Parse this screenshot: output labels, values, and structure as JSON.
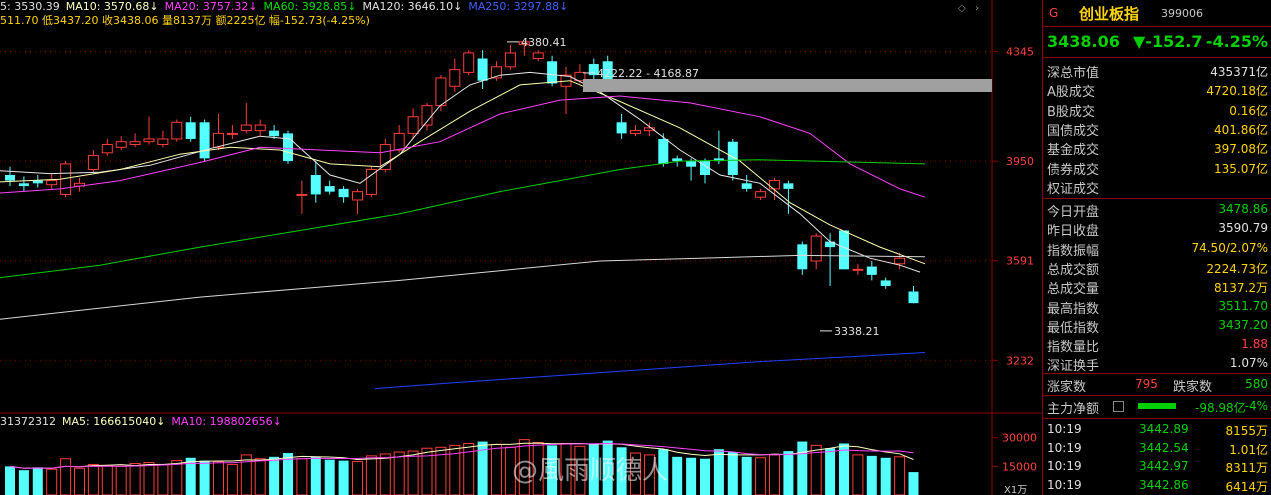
{
  "top_info": [
    {
      "text": "5: 3530.39",
      "color": "#e0e0e0"
    },
    {
      "text": "MA10: 3570.68",
      "color": "#ffffc0"
    },
    {
      "text": "MA20: 3757.32",
      "color": "#ff40ff"
    },
    {
      "text": "MA60: 3928.85",
      "color": "#00e000"
    },
    {
      "text": "MA120: 3646.10",
      "color": "#e0e0e0"
    },
    {
      "text": "MA250: 3297.88",
      "color": "#4060ff"
    }
  ],
  "second_info": "511.70 低3437.20 收3438.06 量8137万 额2225亿 幅-152.73(-4.25%)",
  "vol_info": [
    {
      "text": "31372312",
      "color": "#e0e0e0"
    },
    {
      "text": "MA5: 166615040",
      "color": "#ffffc0"
    },
    {
      "text": "MA10: 198802656",
      "color": "#ff40ff"
    }
  ],
  "chart_data": {
    "type": "candlestick",
    "yticks": [
      4345,
      3950,
      3591,
      3232
    ],
    "ylim": [
      3060,
      4430
    ],
    "vticks": [
      "30000",
      "15000"
    ],
    "vol_unit": "X1万",
    "candles": [
      [
        3900,
        3880,
        3930,
        3860
      ],
      [
        3870,
        3860,
        3895,
        3840
      ],
      [
        3880,
        3870,
        3900,
        3855
      ],
      [
        3865,
        3880,
        3905,
        3850
      ],
      [
        3830,
        3940,
        3950,
        3820
      ],
      [
        3860,
        3870,
        3890,
        3840
      ],
      [
        3920,
        3970,
        3990,
        3910
      ],
      [
        3980,
        4010,
        4030,
        3970
      ],
      [
        4000,
        4020,
        4040,
        3990
      ],
      [
        4010,
        4020,
        4050,
        4000
      ],
      [
        4020,
        4030,
        4110,
        4010
      ],
      [
        4010,
        4030,
        4060,
        4000
      ],
      [
        4030,
        4090,
        4100,
        4020
      ],
      [
        4090,
        4030,
        4110,
        4020
      ],
      [
        4090,
        3960,
        4100,
        3950
      ],
      [
        4000,
        4050,
        4120,
        3990
      ],
      [
        4050,
        4050,
        4080,
        4030
      ],
      [
        4060,
        4080,
        4160,
        4050
      ],
      [
        4060,
        4080,
        4100,
        4040
      ],
      [
        4060,
        4040,
        4080,
        4030
      ],
      [
        4050,
        3950,
        4060,
        3940
      ],
      [
        3830,
        3830,
        3880,
        3760
      ],
      [
        3900,
        3830,
        3950,
        3800
      ],
      [
        3860,
        3840,
        3880,
        3830
      ],
      [
        3850,
        3820,
        3860,
        3800
      ],
      [
        3810,
        3840,
        3850,
        3760
      ],
      [
        3830,
        3920,
        3930,
        3820
      ],
      [
        3920,
        4010,
        4030,
        3910
      ],
      [
        3990,
        4050,
        4080,
        3980
      ],
      [
        4050,
        4110,
        4140,
        4030
      ],
      [
        4080,
        4150,
        4160,
        4060
      ],
      [
        4150,
        4250,
        4260,
        4130
      ],
      [
        4220,
        4280,
        4320,
        4200
      ],
      [
        4270,
        4340,
        4350,
        4260
      ],
      [
        4320,
        4240,
        4350,
        4210
      ],
      [
        4250,
        4290,
        4310,
        4240
      ],
      [
        4290,
        4340,
        4370,
        4280
      ],
      [
        4370,
        4380,
        4381,
        4330
      ],
      [
        4320,
        4340,
        4350,
        4310
      ],
      [
        4310,
        4230,
        4330,
        4220
      ],
      [
        4220,
        4260,
        4290,
        4120
      ],
      [
        4240,
        4270,
        4300,
        4230
      ],
      [
        4300,
        4260,
        4320,
        4230
      ],
      [
        4310,
        4220,
        4330,
        4210
      ],
      [
        4090,
        4050,
        4120,
        4030
      ],
      [
        4050,
        4060,
        4080,
        4040
      ],
      [
        4060,
        4070,
        4090,
        4040
      ],
      [
        4030,
        3940,
        4050,
        3930
      ],
      [
        3960,
        3950,
        3970,
        3930
      ],
      [
        3950,
        3930,
        3960,
        3880
      ],
      [
        3950,
        3900,
        3960,
        3870
      ],
      [
        3960,
        3950,
        4060,
        3940
      ],
      [
        4020,
        3900,
        4030,
        3880
      ],
      [
        3870,
        3850,
        3900,
        3840
      ],
      [
        3820,
        3840,
        3850,
        3810
      ],
      [
        3850,
        3880,
        3890,
        3810
      ],
      [
        3870,
        3850,
        3880,
        3760
      ],
      [
        3650,
        3560,
        3660,
        3540
      ],
      [
        3590,
        3680,
        3690,
        3560
      ],
      [
        3660,
        3640,
        3690,
        3500
      ],
      [
        3700,
        3560,
        3700,
        3560
      ],
      [
        3560,
        3560,
        3580,
        3540
      ],
      [
        3570,
        3540,
        3590,
        3520
      ],
      [
        3520,
        3500,
        3530,
        3490
      ],
      [
        3580,
        3600,
        3620,
        3560
      ],
      [
        3480,
        3438,
        3500,
        3437
      ]
    ],
    "ma": [
      {
        "name": "MA5",
        "color": "#e8e8e8",
        "points": [
          [
            0,
            3915
          ],
          [
            50,
            3905
          ],
          [
            100,
            3910
          ],
          [
            150,
            3935
          ],
          [
            210,
            3995
          ],
          [
            260,
            4040
          ],
          [
            290,
            4030
          ],
          [
            330,
            3900
          ],
          [
            360,
            3870
          ],
          [
            400,
            3975
          ],
          [
            440,
            4150
          ],
          [
            470,
            4225
          ],
          [
            500,
            4260
          ],
          [
            530,
            4270
          ],
          [
            570,
            4255
          ],
          [
            600,
            4200
          ],
          [
            640,
            4100
          ],
          [
            680,
            3990
          ],
          [
            720,
            3900
          ],
          [
            760,
            3870
          ],
          [
            800,
            3760
          ],
          [
            830,
            3660
          ],
          [
            870,
            3600
          ],
          [
            900,
            3575
          ],
          [
            920,
            3550
          ]
        ]
      },
      {
        "name": "MA10",
        "color": "#ffffb0",
        "points": [
          [
            0,
            3875
          ],
          [
            60,
            3885
          ],
          [
            120,
            3920
          ],
          [
            180,
            3975
          ],
          [
            230,
            4000
          ],
          [
            280,
            3990
          ],
          [
            330,
            3940
          ],
          [
            380,
            3930
          ],
          [
            420,
            4020
          ],
          [
            470,
            4130
          ],
          [
            520,
            4225
          ],
          [
            570,
            4240
          ],
          [
            620,
            4165
          ],
          [
            680,
            4070
          ],
          [
            740,
            3950
          ],
          [
            790,
            3800
          ],
          [
            830,
            3720
          ],
          [
            880,
            3640
          ],
          [
            925,
            3580
          ]
        ]
      },
      {
        "name": "MA20",
        "color": "#ff40ff",
        "points": [
          [
            0,
            3835
          ],
          [
            60,
            3850
          ],
          [
            120,
            3880
          ],
          [
            200,
            3945
          ],
          [
            260,
            4000
          ],
          [
            320,
            3990
          ],
          [
            380,
            3980
          ],
          [
            440,
            4020
          ],
          [
            500,
            4120
          ],
          [
            560,
            4170
          ],
          [
            620,
            4185
          ],
          [
            690,
            4160
          ],
          [
            760,
            4110
          ],
          [
            810,
            4050
          ],
          [
            850,
            3940
          ],
          [
            900,
            3850
          ],
          [
            925,
            3820
          ]
        ]
      },
      {
        "name": "MA60",
        "color": "#00d000",
        "points": [
          [
            0,
            3530
          ],
          [
            100,
            3575
          ],
          [
            200,
            3640
          ],
          [
            300,
            3700
          ],
          [
            400,
            3760
          ],
          [
            500,
            3840
          ],
          [
            560,
            3880
          ],
          [
            620,
            3920
          ],
          [
            680,
            3950
          ],
          [
            760,
            3955
          ],
          [
            840,
            3948
          ],
          [
            925,
            3940
          ]
        ]
      },
      {
        "name": "MA120",
        "color": "#d8d8d8",
        "points": [
          [
            0,
            3380
          ],
          [
            100,
            3420
          ],
          [
            200,
            3460
          ],
          [
            300,
            3490
          ],
          [
            400,
            3520
          ],
          [
            500,
            3555
          ],
          [
            600,
            3590
          ],
          [
            700,
            3600
          ],
          [
            800,
            3610
          ],
          [
            925,
            3605
          ]
        ]
      },
      {
        "name": "MA250",
        "color": "#2040ff",
        "points": [
          [
            375,
            3130
          ],
          [
            450,
            3150
          ],
          [
            550,
            3175
          ],
          [
            650,
            3200
          ],
          [
            750,
            3225
          ],
          [
            850,
            3245
          ],
          [
            925,
            3260
          ]
        ]
      }
    ],
    "annotations": [
      {
        "text": "4380.41",
        "x": 507,
        "price": 4380
      },
      {
        "text": "4222.22 - 4168.87",
        "x": 583,
        "price": 4268
      },
      {
        "text": "3338.21",
        "x": 820,
        "price": 3338
      }
    ],
    "volumes": [
      15000,
      13000,
      14500,
      13500,
      19000,
      14000,
      16000,
      15500,
      15000,
      16500,
      17000,
      16000,
      18000,
      19500,
      18000,
      17500,
      16000,
      21000,
      19000,
      20000,
      22000,
      19000,
      20000,
      18500,
      18000,
      17500,
      20500,
      21500,
      22500,
      23000,
      24500,
      25000,
      26000,
      27000,
      28000,
      26500,
      25000,
      29000,
      27500,
      26000,
      27000,
      25500,
      27000,
      28500,
      25000,
      22000,
      21000,
      24000,
      20000,
      19500,
      19000,
      24000,
      22500,
      20000,
      19500,
      21000,
      23000,
      28000,
      26000,
      24500,
      27000,
      21000,
      20500,
      19500,
      20000,
      12000
    ]
  },
  "side": {
    "g_label": "G",
    "name": "创业板指",
    "code": "399006",
    "price": "3438.06",
    "change": "▼-152.7",
    "pct": "-4.25%",
    "market_rows": [
      {
        "k": "深总市值",
        "v": "435371亿",
        "c": "#e0e0e0"
      },
      {
        "k": "A股成交",
        "v": "4720.18亿",
        "c": "#ffd400"
      },
      {
        "k": "B股成交",
        "v": "0.16亿",
        "c": "#ffd400"
      },
      {
        "k": "国债成交",
        "v": "401.86亿",
        "c": "#ffd400"
      },
      {
        "k": "基金成交",
        "v": "397.08亿",
        "c": "#ffd400"
      },
      {
        "k": "债券成交",
        "v": "135.07亿",
        "c": "#ffd400"
      },
      {
        "k": "权证成交",
        "v": "",
        "c": "#ffd400"
      }
    ],
    "stat_rows": [
      {
        "k": "今日开盘",
        "v": "3478.86",
        "c": "#00d000"
      },
      {
        "k": "昨日收盘",
        "v": "3590.79",
        "c": "#e0e0e0"
      },
      {
        "k": "指数振幅",
        "v": "74.50/2.07%",
        "c": "#ffd400"
      },
      {
        "k": "总成交额",
        "v": "2224.73亿",
        "c": "#ffd400"
      },
      {
        "k": "总成交量",
        "v": "8137.2万",
        "c": "#ffd400"
      },
      {
        "k": "最高指数",
        "v": "3511.70",
        "c": "#00d000"
      },
      {
        "k": "最低指数",
        "v": "3437.20",
        "c": "#00d000"
      },
      {
        "k": "指数量比",
        "v": "1.88",
        "c": "#ff4040"
      },
      {
        "k": "深证换手",
        "v": "1.07%",
        "c": "#e0e0e0"
      }
    ],
    "rise_label": "涨家数",
    "rise_value": "795",
    "fall_label": "跌家数",
    "fall_value": "580",
    "main_label": "主力净额",
    "main_value": "-98.98亿",
    "main_pct": "-4%",
    "ticks": [
      {
        "t": "10:19",
        "p": "3442.89",
        "v": "8155万"
      },
      {
        "t": "10:19",
        "p": "3442.54",
        "v": "1.01亿"
      },
      {
        "t": "10:19",
        "p": "3442.97",
        "v": "8311万"
      },
      {
        "t": "10:19",
        "p": "3442.86",
        "v": "6414万"
      }
    ]
  },
  "watermark": "@風雨顺德人"
}
